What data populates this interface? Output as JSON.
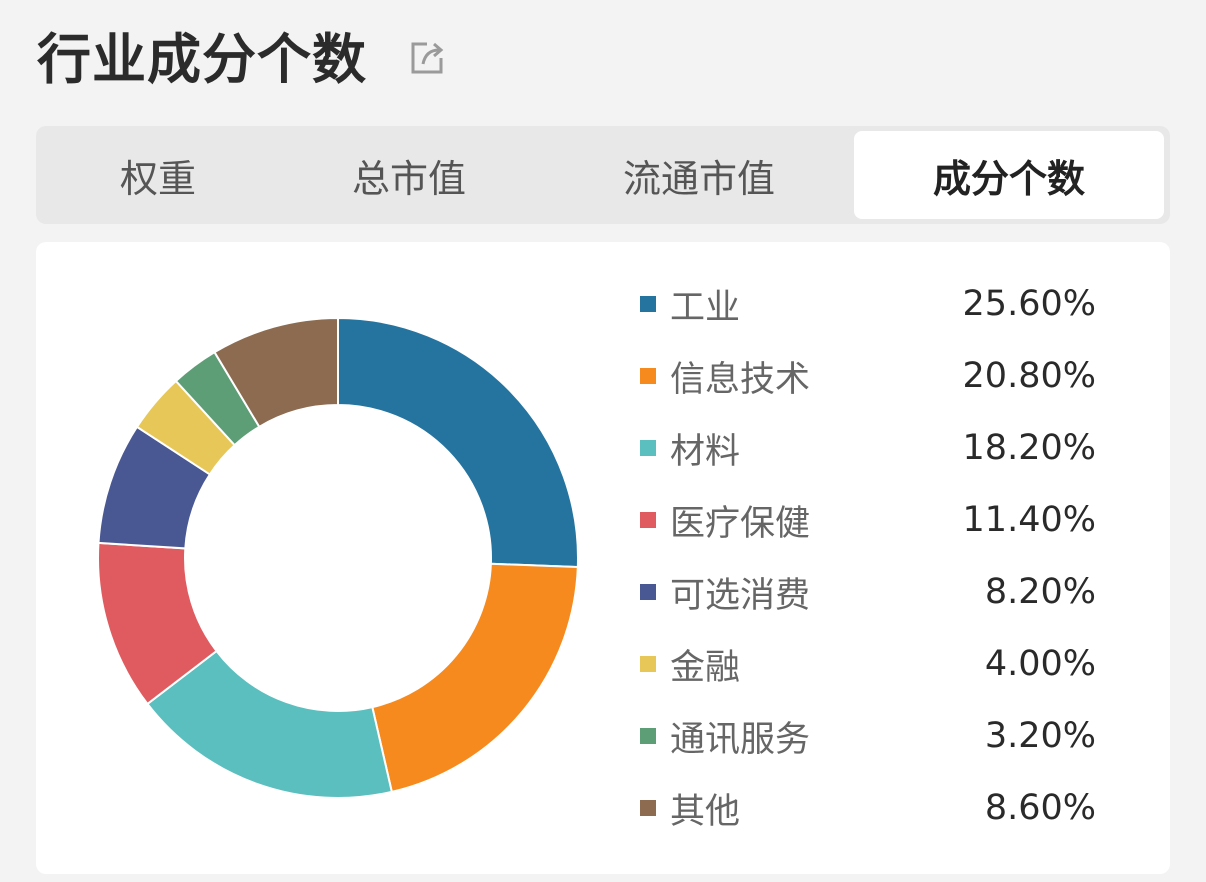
{
  "header": {
    "title": "行业成分个数",
    "share_icon": "share-icon"
  },
  "tabs": [
    {
      "label": "权重",
      "active": false
    },
    {
      "label": "总市值",
      "active": false
    },
    {
      "label": "流通市值",
      "active": false
    },
    {
      "label": "成分个数",
      "active": true
    }
  ],
  "chart_data": {
    "type": "pie",
    "subtype": "donut",
    "title": "",
    "categories": [
      "工业",
      "信息技术",
      "材料",
      "医疗保健",
      "可选消费",
      "金融",
      "通讯服务",
      "其他"
    ],
    "values": [
      25.6,
      20.8,
      18.2,
      11.4,
      8.2,
      4.0,
      3.2,
      8.6
    ],
    "value_labels": [
      "25.60%",
      "20.80%",
      "18.20%",
      "11.40%",
      "8.20%",
      "4.00%",
      "3.20%",
      "8.60%"
    ],
    "colors": [
      "#2574a0",
      "#f68a1e",
      "#5cbfbf",
      "#e05b60",
      "#495893",
      "#e6c757",
      "#5e9e76",
      "#8c6b50"
    ],
    "legend_position": "right"
  }
}
